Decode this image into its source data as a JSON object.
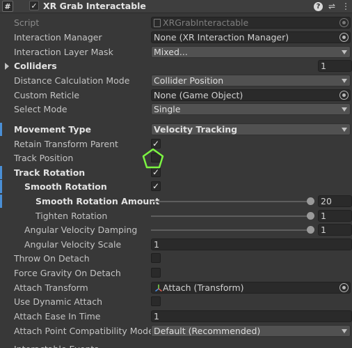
{
  "header": {
    "icon": "#",
    "enabled_check": "✓",
    "title": "XR Grab Interactable",
    "help_icon": "?",
    "preset_icon": "⇌",
    "menu_icon": "⋮"
  },
  "rows": {
    "script": {
      "label": "Script",
      "value": "XRGrabInteractable"
    },
    "interaction_manager": {
      "label": "Interaction Manager",
      "value": "None (XR Interaction Manager)"
    },
    "interaction_layer_mask": {
      "label": "Interaction Layer Mask",
      "value": "Mixed..."
    },
    "colliders": {
      "label": "Colliders",
      "value": "1"
    },
    "distance_calc_mode": {
      "label": "Distance Calculation Mode",
      "value": "Collider Position"
    },
    "custom_reticle": {
      "label": "Custom Reticle",
      "value": "None (Game Object)"
    },
    "select_mode": {
      "label": "Select Mode",
      "value": "Single"
    },
    "movement_type": {
      "label": "Movement Type",
      "value": "Velocity Tracking"
    },
    "retain_transform_parent": {
      "label": "Retain Transform Parent",
      "checked": "✓"
    },
    "track_position": {
      "label": "Track Position",
      "checked": ""
    },
    "track_rotation": {
      "label": "Track Rotation",
      "checked": "✓"
    },
    "smooth_rotation": {
      "label": "Smooth Rotation",
      "checked": "✓"
    },
    "smooth_rotation_amount": {
      "label": "Smooth Rotation Amount",
      "value": "20",
      "slider_fraction": 1.0
    },
    "tighten_rotation": {
      "label": "Tighten Rotation",
      "value": "1",
      "slider_fraction": 1.0
    },
    "angular_velocity_damping": {
      "label": "Angular Velocity Damping",
      "value": "1",
      "slider_fraction": 1.0
    },
    "angular_velocity_scale": {
      "label": "Angular Velocity Scale",
      "value": "1"
    },
    "throw_on_detach": {
      "label": "Throw On Detach",
      "checked": ""
    },
    "force_gravity_on_detach": {
      "label": "Force Gravity On Detach",
      "checked": ""
    },
    "attach_transform": {
      "label": "Attach Transform",
      "value": "Attach (Transform)"
    },
    "use_dynamic_attach": {
      "label": "Use Dynamic Attach",
      "checked": ""
    },
    "attach_ease_in_time": {
      "label": "Attach Ease In Time",
      "value": "1"
    },
    "attach_point_compat_mode": {
      "label": "Attach Point Compatibility Mode",
      "value": "Default (Recommended)"
    },
    "interactable_events": {
      "label": "Interactable Events"
    }
  },
  "colors": {
    "modified_bar": "#4a8fd6",
    "cursor_highlight": "#7cf542"
  }
}
